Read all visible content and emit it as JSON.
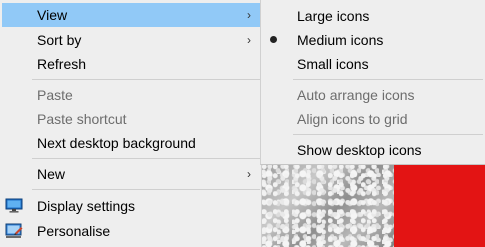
{
  "context_menu": {
    "items": [
      {
        "label": "View",
        "has_submenu": true,
        "state": "highlighted"
      },
      {
        "label": "Sort by",
        "has_submenu": true
      },
      {
        "label": "Refresh"
      },
      {
        "label": "Paste",
        "state": "disabled"
      },
      {
        "label": "Paste shortcut",
        "state": "disabled"
      },
      {
        "label": "Next desktop background"
      },
      {
        "label": "New",
        "has_submenu": true
      },
      {
        "label": "Display settings",
        "icon": "display-settings-icon"
      },
      {
        "label": "Personalise",
        "icon": "personalise-icon"
      }
    ],
    "submenu_arrow": "›"
  },
  "view_submenu": {
    "items": [
      {
        "label": "Large icons"
      },
      {
        "label": "Medium icons",
        "checked": true
      },
      {
        "label": "Small icons"
      },
      {
        "label": "Auto arrange icons",
        "state": "disabled"
      },
      {
        "label": "Align icons to grid",
        "state": "disabled"
      },
      {
        "label": "Show desktop icons"
      }
    ]
  },
  "colors": {
    "menu_background": "#eeeeee",
    "highlight": "#91c9f7",
    "disabled_text": "#6d6d6d",
    "desktop_red": "#e31414"
  }
}
